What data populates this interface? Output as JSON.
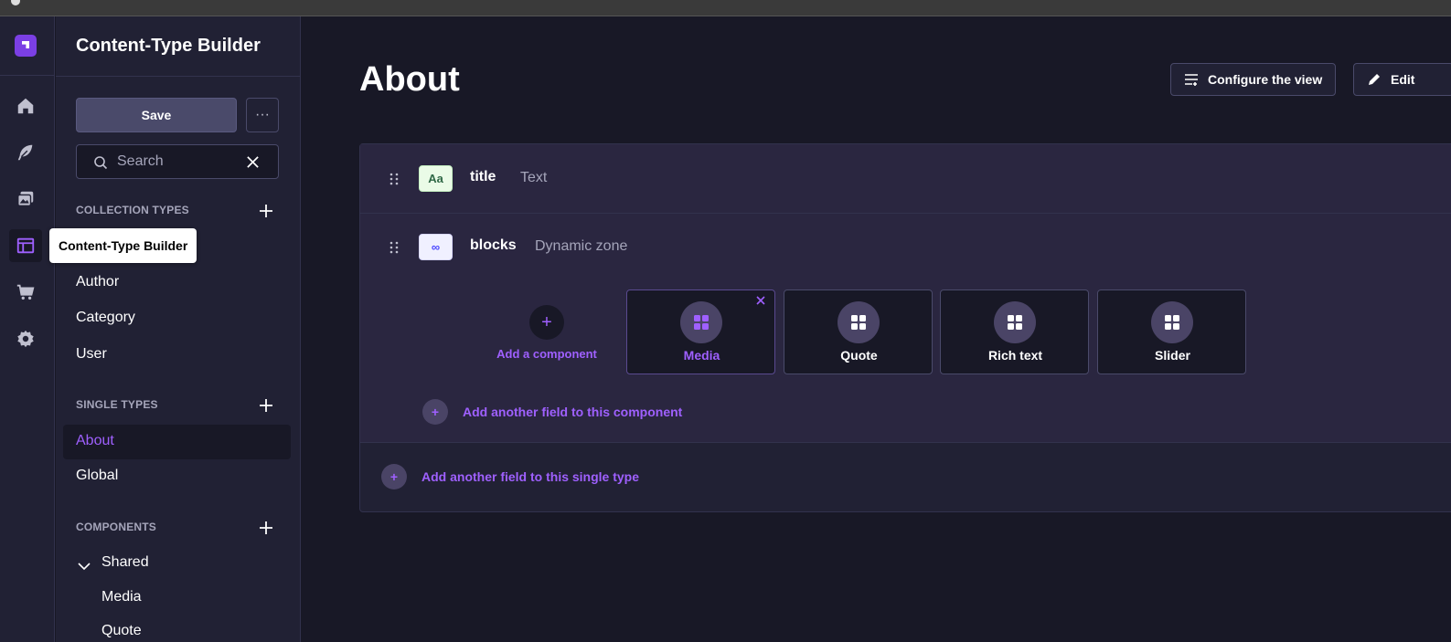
{
  "window": {
    "accent": "#9f60ff",
    "background": "#181826"
  },
  "rail": {
    "items": [
      {
        "name": "home-icon"
      },
      {
        "name": "content-manager-icon"
      },
      {
        "name": "media-library-icon"
      },
      {
        "name": "content-type-builder-icon",
        "active": true
      },
      {
        "name": "marketplace-icon"
      },
      {
        "name": "settings-icon"
      }
    ],
    "tooltip": "Content-Type Builder"
  },
  "subnav": {
    "title": "Content-Type Builder",
    "save_label": "Save",
    "more_label": "···",
    "search_placeholder": "Search",
    "collection_types": {
      "heading": "COLLECTION TYPES",
      "items": [
        "Author",
        "Category",
        "User"
      ]
    },
    "single_types": {
      "heading": "SINGLE TYPES",
      "items": [
        "About",
        "Global"
      ],
      "active": "About"
    },
    "components": {
      "heading": "COMPONENTS",
      "group": "Shared",
      "items": [
        "Media",
        "Quote"
      ]
    }
  },
  "main": {
    "title": "About",
    "configure_label": "Configure the view",
    "edit_label": "Edit",
    "fields": [
      {
        "name": "title",
        "type": "Text",
        "badge": "Aa"
      },
      {
        "name": "blocks",
        "type": "Dynamic zone",
        "badge": "∞"
      }
    ],
    "add_component_label": "Add a component",
    "components": [
      {
        "name": "Media",
        "selected": true
      },
      {
        "name": "Quote"
      },
      {
        "name": "Rich text"
      },
      {
        "name": "Slider"
      }
    ],
    "add_field_component_label": "Add another field to this component",
    "add_field_single_label": "Add another field to this single type"
  }
}
